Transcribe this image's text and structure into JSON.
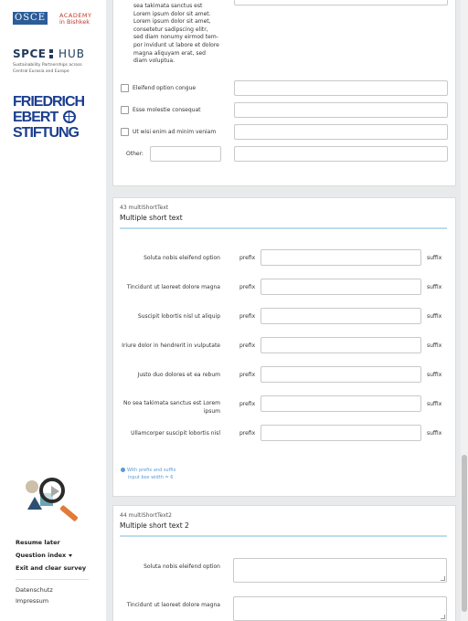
{
  "sidebar": {
    "logos": {
      "osce_mark": "OSCE",
      "osce_line1": "ACADEMY",
      "osce_line2": "in Bishkek",
      "spce_left": "SPCE",
      "spce_right": "HUB",
      "spce_sub1": "Sustainability Partnerships across",
      "spce_sub2": "Central Eurasia and Europe",
      "fes_line1": "FRIEDRICH",
      "fes_line2": "EBERT",
      "fes_line3": "STIFTUNG"
    },
    "nav": {
      "resume": "Resume later",
      "index": "Question index",
      "exit": "Exit and clear survey"
    },
    "footer": {
      "privacy": "Datenschutz",
      "imprint": "Impressum"
    }
  },
  "q42": {
    "text_lines": [
      "sea takimata sanctus est",
      "Lorem ipsum dolor sit amet.",
      "Lorem ipsum dolor sit amet,",
      "consetetur sadipscing elitr,",
      "sed diam nonumy eirmod tem-",
      "por invidunt ut labore et dolore",
      "magna aliquyam erat, sed",
      "diam voluptua."
    ],
    "options": [
      "Eleifend option congue",
      "Esse molestie consequat",
      "Ut wisi enim ad minim veniam"
    ],
    "other_label": "Other:"
  },
  "q43": {
    "code": "43 multiShortText",
    "title": "Multiple short text",
    "prefix": "prefix",
    "suffix": "suffix",
    "rows": [
      "Soluta nobis eleifend option",
      "Tincidunt ut laoreet dolore magna",
      "Suscipit lobortis nisl ut aliquip",
      "Iriure dolor in hendrerit in vulputate",
      "Justo duo dolores et ea rebum",
      "No sea takimata sanctus est Lorem ipsum",
      "Ullamcorper suscipit lobortis nisl"
    ],
    "help_line1": "With prefix and suffix",
    "help_line2": "input box width = 6"
  },
  "q44": {
    "code": "44 multiShortText2",
    "title": "Multiple short text 2",
    "rows": [
      "Soluta nobis eleifend option",
      "Tincidunt ut laoreet dolore magna"
    ]
  },
  "colors": {
    "accent_line": "#bcdcef",
    "help_text": "#5b9bd5",
    "fes_blue": "#1a3d8f",
    "osce_red": "#c0392b"
  }
}
